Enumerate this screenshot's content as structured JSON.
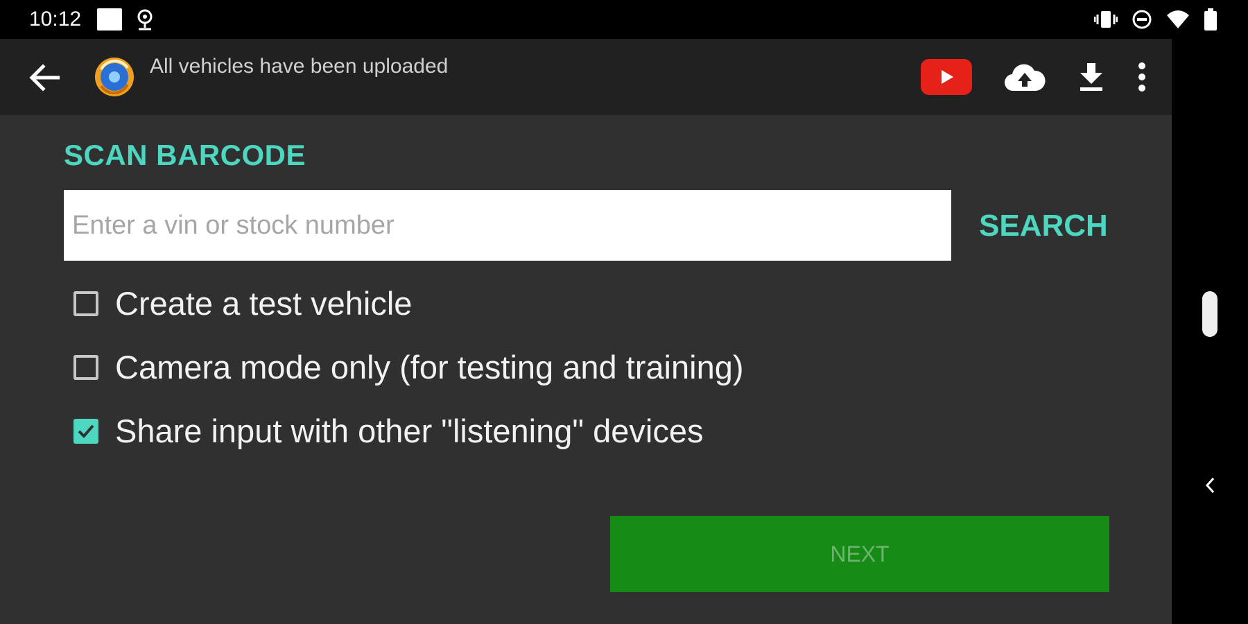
{
  "status_bar": {
    "time": "10:12",
    "left_icons": [
      "notification-square-icon",
      "location-pin-icon"
    ],
    "right_icons": [
      "vibrate-icon",
      "do-not-disturb-icon",
      "wifi-icon",
      "battery-icon"
    ]
  },
  "toolbar": {
    "title": "All vehicles have been uploaded",
    "actions": [
      "youtube-icon",
      "cloud-upload-icon",
      "download-icon",
      "more-vert-icon"
    ]
  },
  "scan": {
    "heading": "SCAN BARCODE",
    "input_placeholder": "Enter a vin or stock number",
    "input_value": "",
    "search_label": "SEARCH"
  },
  "options": [
    {
      "label": "Create a test vehicle",
      "checked": false
    },
    {
      "label": "Camera mode only (for testing and training)",
      "checked": false
    },
    {
      "label": "Share input with other \"listening\" devices",
      "checked": true
    }
  ],
  "next_label": "NEXT",
  "colors": {
    "accent": "#4dd6c0",
    "toolbar_bg": "#212121",
    "content_bg": "#303030",
    "next_bg": "#168c16",
    "next_text": "#6fb26f",
    "youtube_red": "#e62117"
  }
}
